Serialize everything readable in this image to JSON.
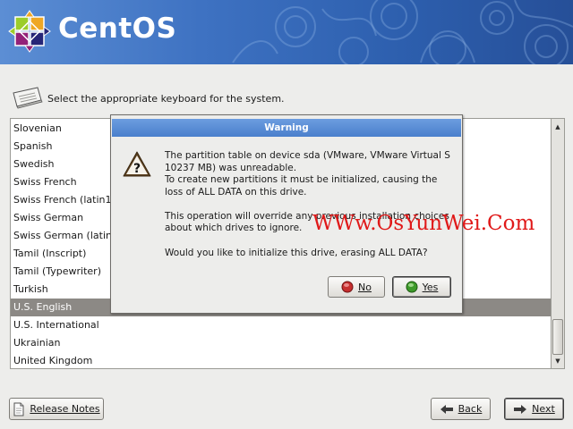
{
  "header": {
    "brand_name": "CentOS",
    "background_color": "#3a6dbf"
  },
  "prompt": {
    "icon": "keyboard-icon",
    "text": "Select the appropriate keyboard for the system."
  },
  "keyboard_list": {
    "items": [
      "Slovenian",
      "Spanish",
      "Swedish",
      "Swiss French",
      "Swiss French (latin1",
      "Swiss German",
      "Swiss German (latin",
      "Tamil (Inscript)",
      "Tamil (Typewriter)",
      "Turkish",
      "U.S. English",
      "U.S. International",
      "Ukrainian",
      "United Kingdom"
    ],
    "selected": "U.S. English",
    "selection_color": "#8c8985"
  },
  "dialog": {
    "title": "Warning",
    "icon": "question-icon",
    "message_1": "The partition table on device sda (VMware, VMware Virtual S",
    "message_2": "10237 MB) was unreadable.",
    "message_3": "To create new partitions it must be initialized, causing the",
    "message_4": "loss of ALL DATA on this drive.",
    "message_5": "This operation will override any previous installation choices",
    "message_6": "about which drives to ignore.",
    "question": "Would you like to initialize this drive, erasing ALL DATA?",
    "no_label": "No",
    "yes_label": "Yes",
    "title_color": "#5a8dd6"
  },
  "footer": {
    "release_notes_label": "Release Notes",
    "back_label": "Back",
    "next_label": "Next"
  },
  "watermark": {
    "text": "WWw.OsYunWei.Com",
    "color": "#e01919"
  }
}
